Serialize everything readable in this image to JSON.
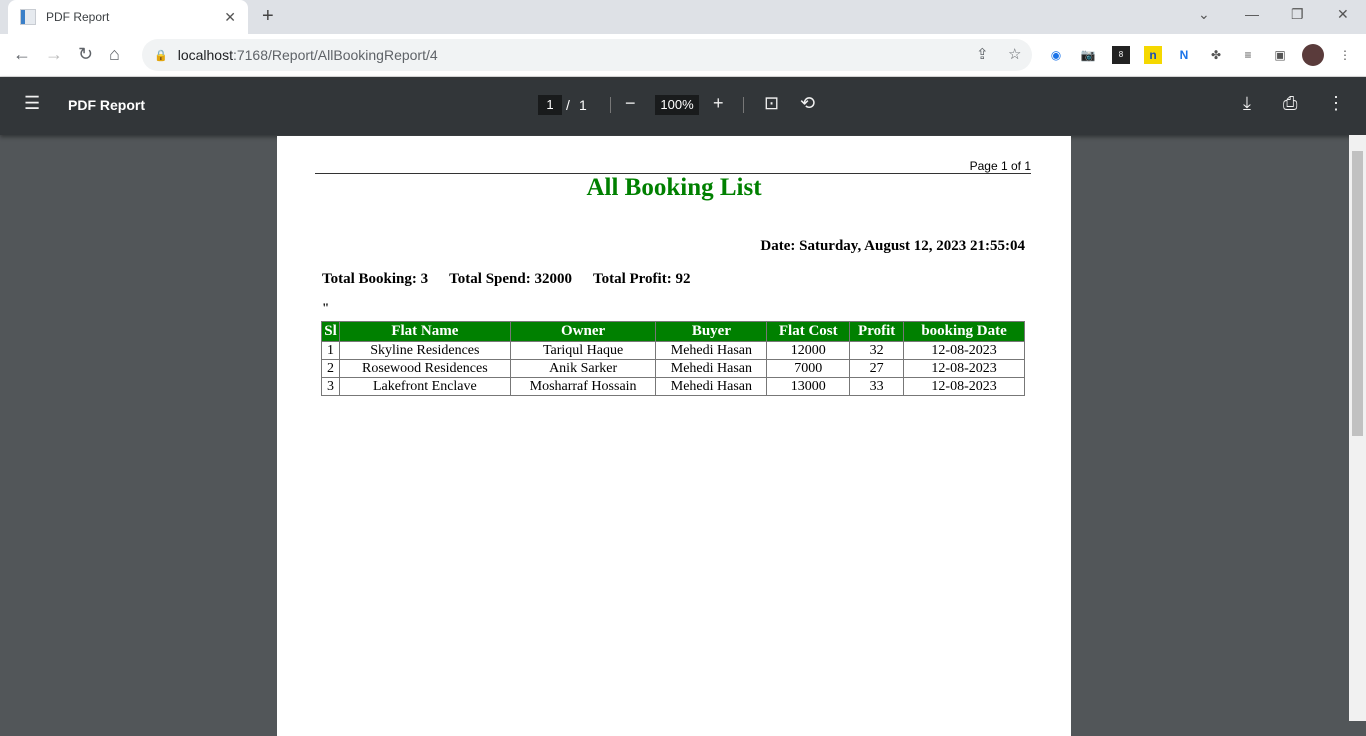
{
  "browser": {
    "tab_title": "PDF Report",
    "url_host": "localhost",
    "url_path": ":7168/Report/AllBookingReport/4",
    "ext_badge": "8"
  },
  "viewer": {
    "title": "PDF Report",
    "current_page": "1",
    "page_sep": "/",
    "total_pages": "1",
    "zoom": "100%"
  },
  "report": {
    "page_label": "Page 1 of 1",
    "title": "All Booking List",
    "date": "Date: Saturday, August 12, 2023 21:55:04",
    "total_booking": "Total Booking: 3",
    "total_spend": "Total Spend: 32000",
    "total_profit": "Total Profit: 92",
    "stray_text": "\"",
    "columns": [
      "Sl",
      "Flat Name",
      "Owner",
      "Buyer",
      "Flat Cost",
      "Profit",
      "booking Date"
    ],
    "rows": [
      [
        "1",
        "Skyline Residences",
        "Tariqul Haque",
        "Mehedi Hasan",
        "12000",
        "32",
        "12-08-2023"
      ],
      [
        "2",
        "Rosewood Residences",
        "Anik Sarker",
        "Mehedi Hasan",
        "7000",
        "27",
        "12-08-2023"
      ],
      [
        "3",
        "Lakefront Enclave",
        "Mosharraf Hossain",
        "Mehedi Hasan",
        "13000",
        "33",
        "12-08-2023"
      ]
    ]
  }
}
